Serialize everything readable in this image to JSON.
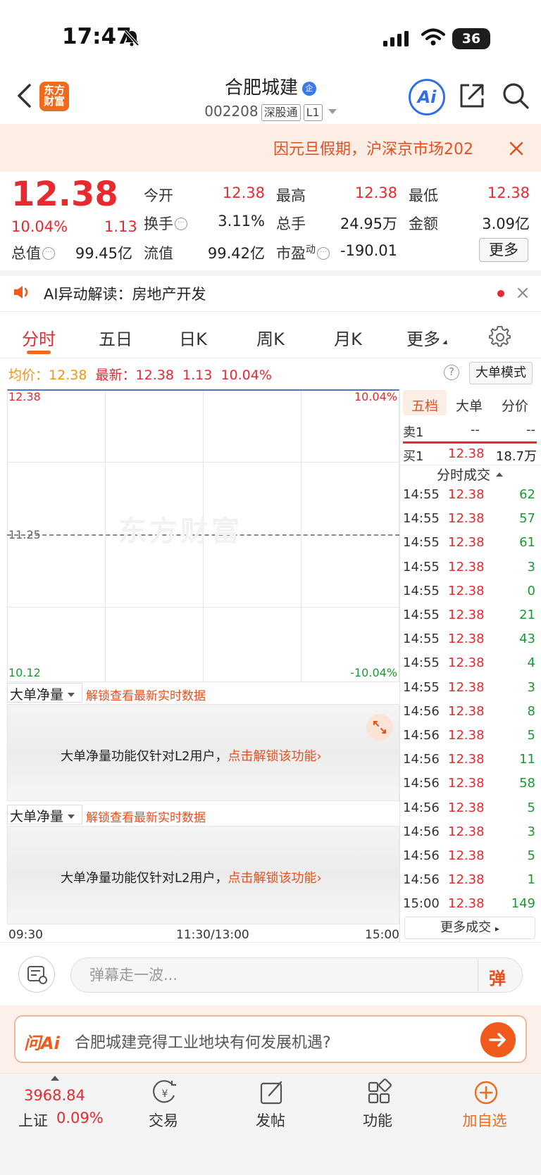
{
  "status_bar": {
    "time": "17:47",
    "battery": "36"
  },
  "header": {
    "logo_text_line1": "东方",
    "logo_text_line2": "财富",
    "stock_name": "合肥城建",
    "enterprise_badge": "企",
    "stock_code": "002208",
    "market_tag": "深股通",
    "level_tag": "L1",
    "ai_label": "Ai"
  },
  "notice": {
    "text": "因元旦假期，沪深京市场202"
  },
  "quote": {
    "price": "12.38",
    "change_pct": "10.04%",
    "change_abs": "1.13",
    "open_label": "今开",
    "open_value": "12.38",
    "high_label": "最高",
    "high_value": "12.38",
    "low_label": "最低",
    "low_value": "12.38",
    "turnover_rate_label": "换手",
    "turnover_rate_value": "3.11%",
    "volume_label": "总手",
    "volume_value": "24.95万",
    "amount_label": "金额",
    "amount_value": "3.09亿",
    "market_cap_label": "总值",
    "market_cap_value": "99.45亿",
    "float_cap_label": "流值",
    "float_cap_value": "99.42亿",
    "pe_label": "市盈",
    "pe_sup": "动",
    "pe_value": "-190.01",
    "more_label": "更多"
  },
  "ai_row": {
    "label": "AI异动解读：",
    "topic": "房地产开发"
  },
  "tabs": [
    "分时",
    "五日",
    "日K",
    "周K",
    "月K",
    "更多"
  ],
  "price_line": {
    "avg_label": "均价：",
    "avg_value": "12.38",
    "latest_label": "最新：",
    "latest_value": "12.38",
    "latest_change": "1.13",
    "latest_pct": "10.04%",
    "help": "?",
    "big_order_mode": "大单模式"
  },
  "chart": {
    "top_price": "12.38",
    "top_pct": "10.04%",
    "mid_price": "11.25",
    "bottom_price": "10.12",
    "bottom_pct": "-10.04%",
    "watermark": "东方财富",
    "time_start": "09:30",
    "time_mid": "11:30/13:00",
    "time_end": "15:00"
  },
  "panels": [
    {
      "dropdown": "大单净量",
      "link": "解锁查看最新实时数据",
      "message": "大单净量功能仅针对L2用户，",
      "cta": "点击解锁该功能"
    },
    {
      "dropdown": "大单净量",
      "link": "解锁查看最新实时数据",
      "message": "大单净量功能仅针对L2用户，",
      "cta": "点击解锁该功能"
    }
  ],
  "right_panel": {
    "tabs": [
      "五档",
      "大单",
      "分价"
    ],
    "sell1_label": "卖1",
    "sell1_price": "--",
    "sell1_vol": "--",
    "buy1_label": "买1",
    "buy1_price": "12.38",
    "buy1_vol": "18.7万",
    "trades_title": "分时成交",
    "trades": [
      {
        "time": "14:55",
        "price": "12.38",
        "vol": "62"
      },
      {
        "time": "14:55",
        "price": "12.38",
        "vol": "57"
      },
      {
        "time": "14:55",
        "price": "12.38",
        "vol": "61"
      },
      {
        "time": "14:55",
        "price": "12.38",
        "vol": "3"
      },
      {
        "time": "14:55",
        "price": "12.38",
        "vol": "0"
      },
      {
        "time": "14:55",
        "price": "12.38",
        "vol": "21"
      },
      {
        "time": "14:55",
        "price": "12.38",
        "vol": "43"
      },
      {
        "time": "14:55",
        "price": "12.38",
        "vol": "4"
      },
      {
        "time": "14:55",
        "price": "12.38",
        "vol": "3"
      },
      {
        "time": "14:56",
        "price": "12.38",
        "vol": "8"
      },
      {
        "time": "14:56",
        "price": "12.38",
        "vol": "5"
      },
      {
        "time": "14:56",
        "price": "12.38",
        "vol": "11"
      },
      {
        "time": "14:56",
        "price": "12.38",
        "vol": "58"
      },
      {
        "time": "14:56",
        "price": "12.38",
        "vol": "5"
      },
      {
        "time": "14:56",
        "price": "12.38",
        "vol": "3"
      },
      {
        "time": "14:56",
        "price": "12.38",
        "vol": "5"
      },
      {
        "time": "14:56",
        "price": "12.38",
        "vol": "1"
      },
      {
        "time": "15:00",
        "price": "12.38",
        "vol": "149"
      }
    ],
    "more_trades": "更多成交"
  },
  "danmaku": {
    "placeholder": "弹幕走一波...",
    "send": "弹"
  },
  "ask_ai": {
    "logo": "问Ai",
    "question": "合肥城建竞得工业地块有何发展机遇?"
  },
  "bottom_nav": {
    "index_value": "3968.84",
    "index_name": "上证",
    "index_pct": "0.09%",
    "items": [
      "交易",
      "发帖",
      "功能",
      "加自选"
    ]
  },
  "colors": {
    "up": "#e8292f",
    "down": "#1a9a32",
    "accent": "#f06a1c",
    "ai_blue": "#2f6fe6"
  }
}
